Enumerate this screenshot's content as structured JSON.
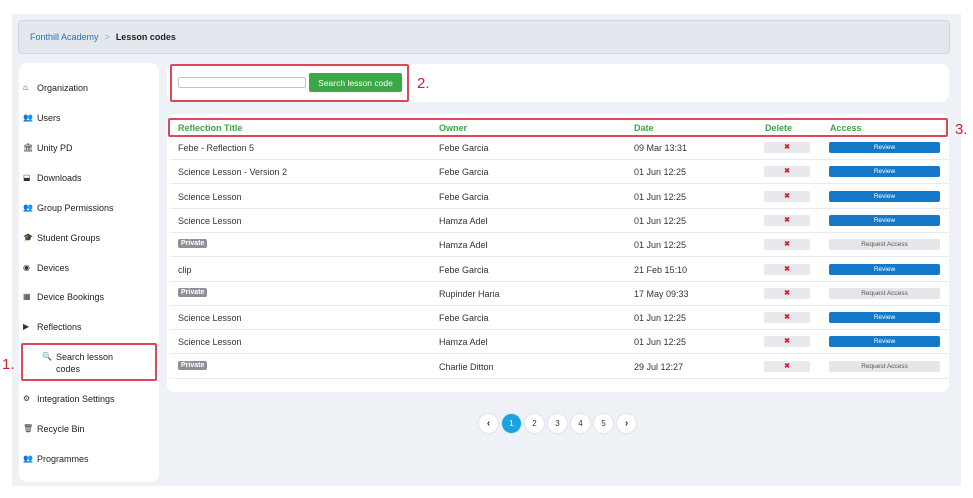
{
  "breadcrumb": {
    "root": "Fonthill Academy",
    "separator": ">",
    "current": "Lesson codes"
  },
  "sidebar": {
    "items": [
      {
        "label": "Organization",
        "icon": "home-icon",
        "glyph": "⌂"
      },
      {
        "label": "Users",
        "icon": "users-icon",
        "glyph": "👥"
      },
      {
        "label": "Unity PD",
        "icon": "institution-icon",
        "glyph": "🏛"
      },
      {
        "label": "Downloads",
        "icon": "download-icon",
        "glyph": "⬓"
      },
      {
        "label": "Group Permissions",
        "icon": "users-icon",
        "glyph": "👥"
      },
      {
        "label": "Student Groups",
        "icon": "graduation-cap-icon",
        "glyph": "🎓"
      },
      {
        "label": "Devices",
        "icon": "camera-icon",
        "glyph": "◉"
      },
      {
        "label": "Device Bookings",
        "icon": "calendar-icon",
        "glyph": "▦"
      },
      {
        "label": "Reflections",
        "icon": "play-icon",
        "glyph": "▶"
      },
      {
        "label": "Search lesson codes",
        "icon": "search-icon",
        "glyph": "🔍"
      },
      {
        "label": "Integration Settings",
        "icon": "cogs-icon",
        "glyph": "⚙"
      },
      {
        "label": "Recycle Bin",
        "icon": "trash-icon",
        "glyph": "🗑"
      },
      {
        "label": "Programmes",
        "icon": "users-icon",
        "glyph": "👥"
      }
    ]
  },
  "search": {
    "value": "",
    "placeholder": "",
    "button_label": "Search lesson code"
  },
  "annotations": {
    "one": "1.",
    "two": "2.",
    "three": "3."
  },
  "table": {
    "headers": {
      "title": "Reflection Title",
      "owner": "Owner",
      "date": "Date",
      "delete": "Delete",
      "access": "Access"
    },
    "private_label": "Private",
    "delete_glyph": "✖",
    "rows": [
      {
        "title": "Febe - Reflection 5",
        "private": false,
        "owner": "Febe Garcia",
        "date": "09 Mar 13:31",
        "access": "Review"
      },
      {
        "title": "Science Lesson - Version 2",
        "private": false,
        "owner": "Febe Garcia",
        "date": "01 Jun 12:25",
        "access": "Review"
      },
      {
        "title": "Science Lesson",
        "private": false,
        "owner": "Febe Garcia",
        "date": "01 Jun 12:25",
        "access": "Review"
      },
      {
        "title": "Science Lesson",
        "private": false,
        "owner": "Hamza Adel",
        "date": "01 Jun 12:25",
        "access": "Review"
      },
      {
        "title": "",
        "private": true,
        "owner": "Hamza Adel",
        "date": "01 Jun 12:25",
        "access": "Request Access"
      },
      {
        "title": "clip",
        "private": false,
        "owner": "Febe Garcia",
        "date": "21 Feb 15:10",
        "access": "Review"
      },
      {
        "title": "",
        "private": true,
        "owner": "Rupinder Haria",
        "date": "17 May 09:33",
        "access": "Request Access"
      },
      {
        "title": "Science Lesson",
        "private": false,
        "owner": "Febe Garcia",
        "date": "01 Jun 12:25",
        "access": "Review"
      },
      {
        "title": "Science Lesson",
        "private": false,
        "owner": "Hamza Adel",
        "date": "01 Jun 12:25",
        "access": "Review"
      },
      {
        "title": "",
        "private": true,
        "owner": "Charlie Ditton",
        "date": "29 Jul 12:27",
        "access": "Request Access"
      }
    ]
  },
  "pagination": {
    "prev": "‹",
    "next": "›",
    "pages": [
      "1",
      "2",
      "3",
      "4",
      "5"
    ],
    "current": "1"
  },
  "colors": {
    "accent_green": "#3aa845",
    "review_blue": "#1479c8",
    "highlight_red": "#e0465a",
    "page_active": "#1aa3dc"
  }
}
